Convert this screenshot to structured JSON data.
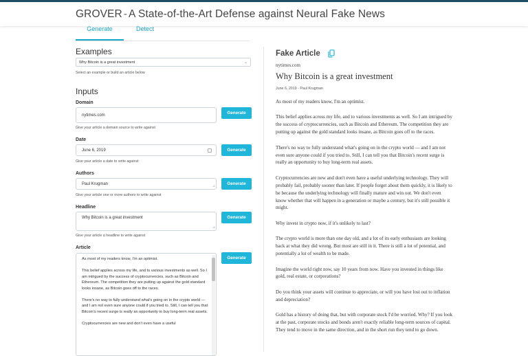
{
  "header": {
    "title_main": "GROVER",
    "title_sep": "-",
    "title_rest": "A State-of-the-Art Defense against Neural Fake News"
  },
  "tabs": [
    {
      "label": "Generate"
    },
    {
      "label": "Detect"
    }
  ],
  "examples": {
    "title": "Examples",
    "selected": "Why Bitcoin is a great investment",
    "hint": "Select an example or build an article below"
  },
  "inputs": {
    "title": "Inputs",
    "domain": {
      "label": "Domain",
      "value": "nytimes.com",
      "hint": "Give your article a domain source to write against",
      "button": "Generate"
    },
    "date": {
      "label": "Date",
      "value": "June 6, 2019",
      "hint": "Give your article a date to write against",
      "button": "Generate"
    },
    "authors": {
      "label": "Authors",
      "value": "Paul Krugman",
      "hint": "Give your article one or more authors to write against",
      "button": "Generate"
    },
    "headline": {
      "label": "Headline",
      "value": "Why Bitcoin is a great investment",
      "hint": "Give your article a headline to write against",
      "button": "Generate"
    },
    "article": {
      "label": "Article",
      "button": "Generate",
      "paragraphs": [
        "As most of my readers know, I'm an optimist.",
        "This belief applies across my life, and to various investments as well. So I am intrigued by the success of cryptocurrencies, such as Bitcoin and Ethereum. The competition they are putting up against the gold standard looks insane, as Bitcoin goes off to the races.",
        "There's no way to fully understand what's going on in the crypto world — and I am not even sure anyone could if you tried to. Still, I can tell you that Bitcoin's recent surge is really an opportunity to buy long-term real assets.",
        "Cryptocurrencies are new and don't even have a useful"
      ]
    }
  },
  "fake_article": {
    "title": "Fake Article",
    "domain": "nytimes.com",
    "headline": "Why Bitcoin is a great investment",
    "meta": "June 6, 2019 - Paul Krugman",
    "paragraphs": [
      "As most of my readers know, I'm an optimist.",
      "This belief applies across my life, and to various investments as well. So I am intrigued by the success of cryptocurrencies, such as Bitcoin and Ethereum. The competition they are putting up against the gold standard looks insane, as Bitcoin goes off to the races.",
      "There's no way to fully understand what's going on in the crypto world — and I am not even sure anyone could if you tried to. Still, I can tell you that Bitcoin's recent surge is really an opportunity to buy long-term real assets.",
      "Cryptocurrencies are new and don't even have a useful underlying technology. They will probably fail, probably sooner than later. If people forget about them quickly, it is likely to be because the underlying technology will finally mature and win out. We don't even know whether that will happen in a generation or maybe a century, but it's still possible it might.",
      "Why invest in crypto now, if it's unlikely to last?",
      "The crypto world is more than one day old, and a lot of its early enthusiasts are looking back at what they did wrong. But most are still in it. There is still a lot of potential, and potentially a lot of wealth to be made.",
      "Imagine the world right now, say 10 years from now. Have you invested in things like gold, real estate, or corporations?",
      "Do you think your assets will continue to appreciate, or will you have lost out to inflation and depreciation?",
      "Gold has a history of doing that, but with corporate stock I'd be worried. Why? If you look at the past, corporate stocks and bonds aren't exactly reliable long-term sources of capital. They tend to move in the same direction, and in the short run they tend to go down."
    ]
  },
  "colors": {
    "accent": "#1fb6d9",
    "topbar": "#1f4f66"
  }
}
